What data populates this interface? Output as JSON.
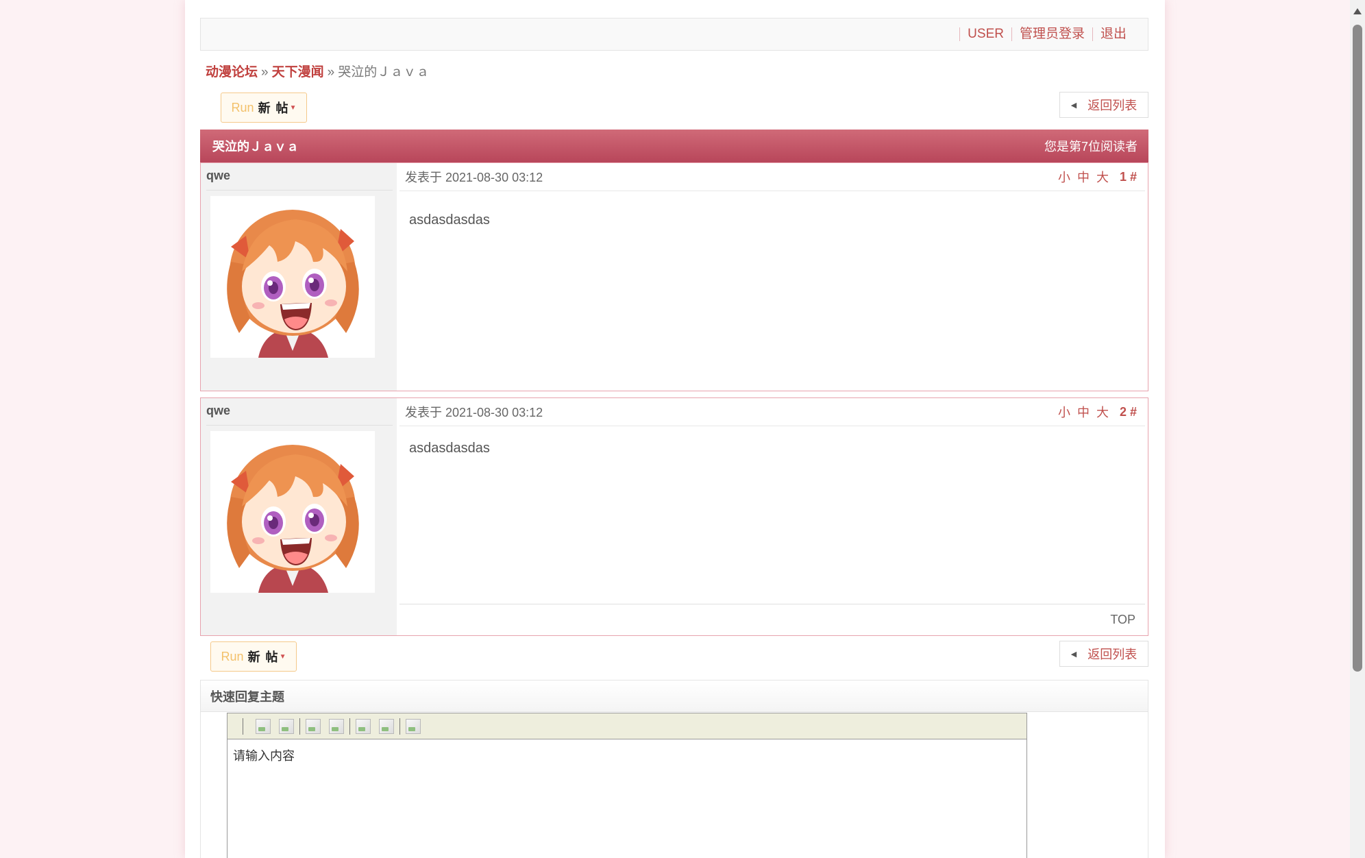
{
  "topbar": {
    "user_link": "USER",
    "admin_login_link": "管理员登录",
    "logout_link": "退出"
  },
  "breadcrumb": {
    "forum": "动漫论坛",
    "separator": "»",
    "board": "天下漫闻",
    "topic": "哭泣的Ｊａｖａ"
  },
  "actions": {
    "run_label": "Run",
    "new_post_label": "新帖",
    "back_to_list_label": "返回列表"
  },
  "thread": {
    "title": "哭泣的Ｊａｖａ",
    "reader_info": "您是第7位阅读者"
  },
  "posts": [
    {
      "username": "qwe",
      "posted_at": "发表于 2021-08-30 03:12",
      "font_small": "小",
      "font_medium": "中",
      "font_large": "大",
      "floor": "1 #",
      "content": "asdasdasdas"
    },
    {
      "username": "qwe",
      "posted_at": "发表于 2021-08-30 03:12",
      "font_small": "小",
      "font_medium": "中",
      "font_large": "大",
      "floor": "2 #",
      "content": "asdasdasdas",
      "top_link": "TOP"
    }
  ],
  "quick_reply": {
    "title": "快速回复主题",
    "editor_placeholder": "请输入内容"
  },
  "colors": {
    "accent": "#c0504d",
    "header_bar": "#c45a6b",
    "post_border": "#e7a2ad",
    "page_bg": "#fdf2f4"
  }
}
